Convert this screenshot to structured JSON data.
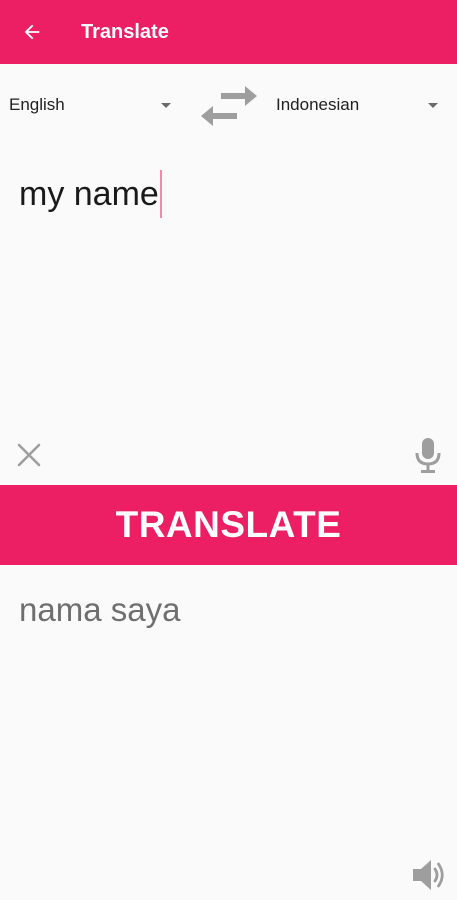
{
  "app_bar": {
    "title": "Translate",
    "back_icon": "arrow-left-icon",
    "color": "#ec1e64"
  },
  "languages": {
    "source": "English",
    "target": "Indonesian",
    "swap_icon": "swap-arrows-icon"
  },
  "input": {
    "text": "my name",
    "clear_icon": "close-icon",
    "mic_icon": "microphone-icon"
  },
  "translate_button": {
    "label": "TRANSLATE"
  },
  "output": {
    "text": "nama saya",
    "speaker_icon": "speaker-icon"
  }
}
